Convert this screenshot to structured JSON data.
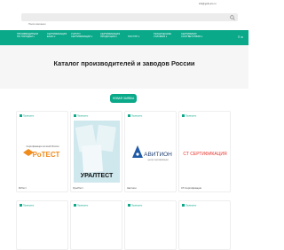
{
  "header": {
    "contact": "info@gufo-pro.ru",
    "search_placeholder": "Поиск компании"
  },
  "nav": [
    {
      "label": "ПРОИЗВОДИТЕЛИ\nПО ГОРОДАМ ▾"
    },
    {
      "label": "СЕРТИФИКАЦИЯ\nЕАЭС ▾"
    },
    {
      "label": "УСЛУГИ\nСЕРТИФИКАЦИИ ▾"
    },
    {
      "label": "СЕРТИФИКАЦИЯ\nПРОДУКЦИИ ▾"
    },
    {
      "label": "ГОСТ/ТР ▾"
    },
    {
      "label": "ТЕХНИЧЕСКИЕ\nУСЛОВИЯ ▾"
    },
    {
      "label": "СЕРТИФИКАТ\nСООТВЕТСТВИЯ ▾"
    }
  ],
  "nav_icons": "☰ ⚙",
  "title": "Каталог производителей и заводов России",
  "cta_label": "НОВАЯ ЗАЯВКА",
  "cards": [
    {
      "badge": "Проверено",
      "name": "РоТест",
      "logo_text": "РоТЕСТ",
      "logo_caption": "Сертификация по всей России"
    },
    {
      "badge": "Проверено",
      "name": "УралТест",
      "logo_text": "УРАЛТЕСТ"
    },
    {
      "badge": "Проверено",
      "name": "Авитион",
      "logo_text": "АВИТИОН",
      "logo_caption": "центр сертификации"
    },
    {
      "badge": "Проверено",
      "name": "СТ-Сертификация",
      "logo_text": "СТ СЕРТИФИКАЦИЯ"
    }
  ],
  "row2_badges": [
    "Проверено",
    "Проверено",
    "Проверено",
    "Проверено"
  ],
  "colors": {
    "accent": "#0aa98a",
    "red": "#e8322a",
    "orange": "#f08b1e"
  }
}
